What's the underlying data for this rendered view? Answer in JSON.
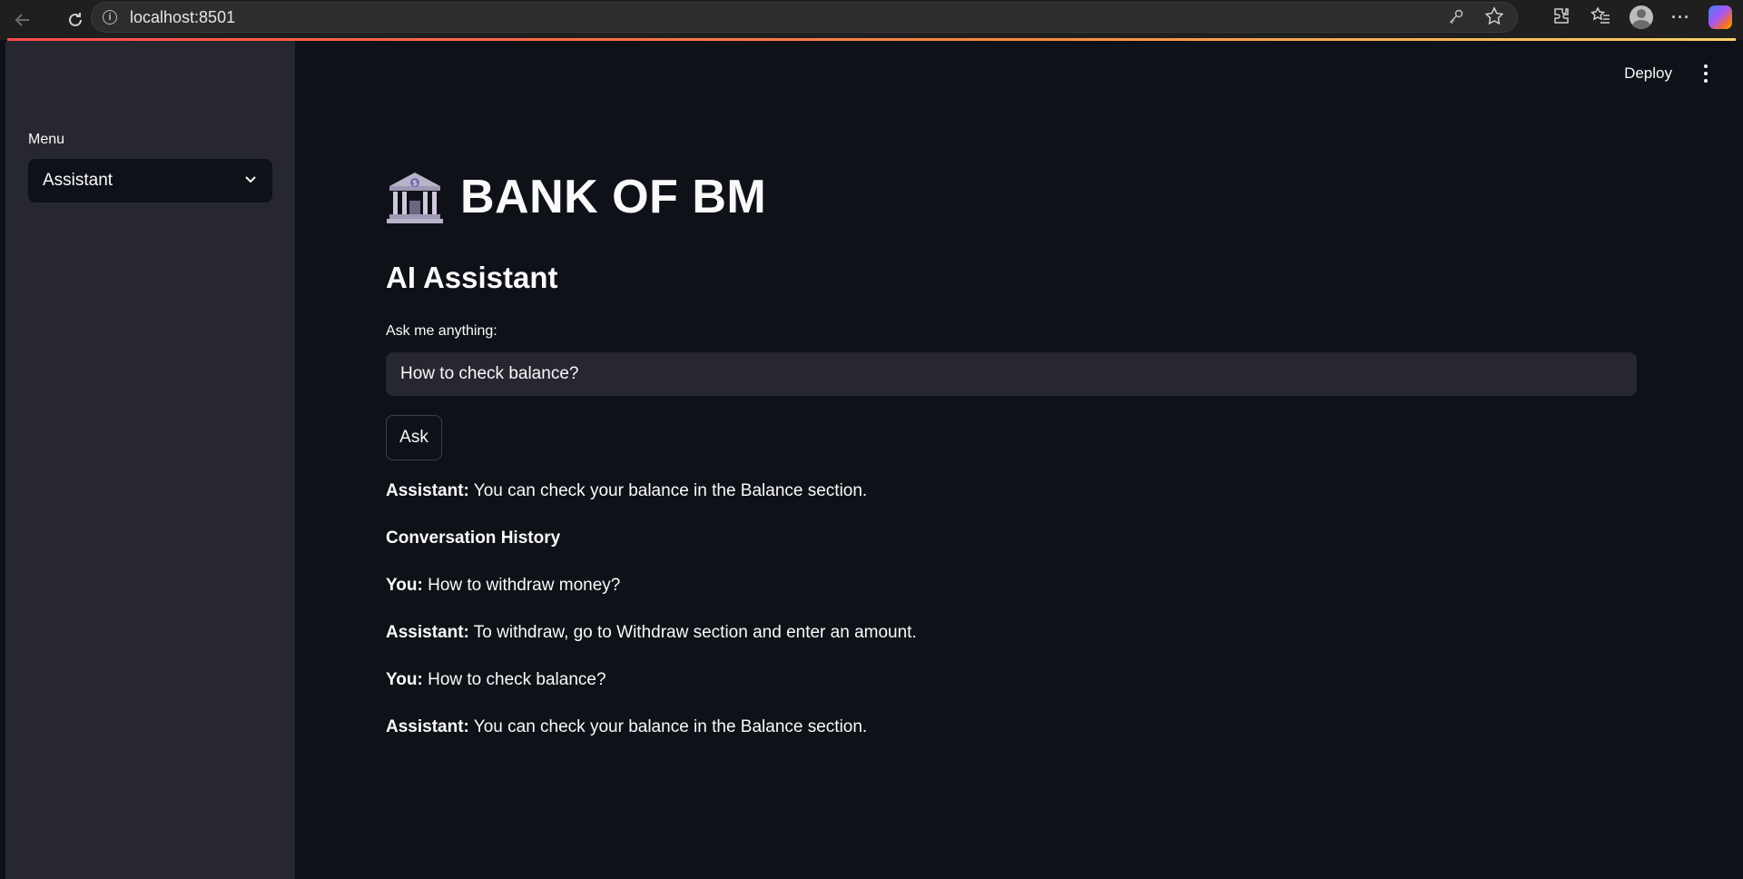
{
  "browser": {
    "url": "localhost:8501",
    "icons": [
      "back-icon",
      "reload-icon",
      "info-icon",
      "key-icon",
      "star-icon",
      "extensions-icon",
      "favorites-icon",
      "profile-icon",
      "more-icon",
      "copilot-icon"
    ]
  },
  "header": {
    "deploy_label": "Deploy"
  },
  "sidebar": {
    "menu_label": "Menu",
    "selected_option": "Assistant"
  },
  "main": {
    "title": "BANK OF BM",
    "subtitle": "AI Assistant",
    "input_label": "Ask me anything:",
    "input_value": "How to check balance?",
    "ask_button": "Ask",
    "response": {
      "speaker": "Assistant:",
      "text": " You can check your balance in the Balance section."
    },
    "history_heading": "Conversation History",
    "history": [
      {
        "speaker": "You:",
        "text": " How to withdraw money?"
      },
      {
        "speaker": "Assistant:",
        "text": " To withdraw, go to Withdraw section and enter an amount."
      },
      {
        "speaker": "You:",
        "text": " How to check balance?"
      },
      {
        "speaker": "Assistant:",
        "text": " You can check your balance in the Balance section."
      }
    ]
  },
  "colors": {
    "background": "#0e1117",
    "sidebar": "#262730",
    "input_bg": "#262730",
    "accent": "#ff4b4b"
  }
}
